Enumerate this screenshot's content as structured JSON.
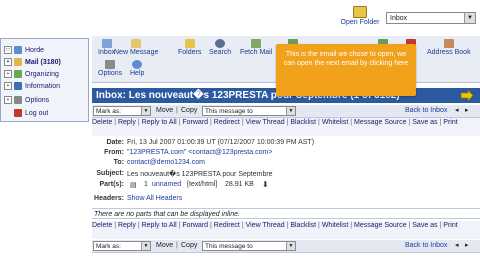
{
  "top": {
    "open_folder_label": "Open Folder",
    "folder_select_value": "Inbox"
  },
  "sidebar": {
    "items": [
      {
        "label": "Horde"
      },
      {
        "label": "Mail (3180)"
      },
      {
        "label": "Organizing"
      },
      {
        "label": "Information"
      },
      {
        "label": "Options"
      },
      {
        "label": "Log out"
      }
    ]
  },
  "toolbar": {
    "buttons": [
      {
        "label": "Inbox"
      },
      {
        "label": "New Message"
      },
      {
        "label": "Folders"
      },
      {
        "label": "Search"
      },
      {
        "label": "Fetch Mail"
      },
      {
        "label": "Address Book"
      },
      {
        "label": "Options"
      },
      {
        "label": "Help"
      }
    ]
  },
  "callout": {
    "text": "This is the email we chose to open, we can open the next email by clicking here"
  },
  "message": {
    "title": "Inbox: Les nouveaut�s 123PRESTA pour Septembre (1 of 3182)"
  },
  "actions": {
    "mark_as": "Mark as:",
    "move": "Move",
    "copy": "Copy",
    "this_message_to": "This message to",
    "back_to_inbox": "Back to Inbox"
  },
  "links": {
    "row": [
      "Delete",
      "Reply",
      "Reply to All",
      "Forward",
      "Redirect",
      "View Thread",
      "Blacklist",
      "Whitelist",
      "Message Source",
      "Save as",
      "Print"
    ]
  },
  "headers": {
    "date_label": "Date:",
    "date_value": "Fri, 13 Jul 2007 01:00:39 UT (07/12/2007 10:00:39 PM AST)",
    "from_label": "From:",
    "from_value": "\"123PRESTA.com\" <contact@123presta.com>",
    "to_label": "To:",
    "to_value": "contact@demo1234.com",
    "subject_label": "Subject:",
    "subject_value": "Les nouveaut�s 123PRESTA pour Septembre",
    "parts_label": "Part(s):",
    "parts_num": "1",
    "parts_name": "unnamed",
    "parts_type": "[text/html]",
    "parts_size": "28.91 KB",
    "headers_label": "Headers:",
    "headers_value": "Show All Headers"
  },
  "body": {
    "no_parts": "There are no parts that can be displayed inline."
  },
  "colors": {
    "title_bar": "#2c5aa0",
    "callout": "#f2a11a",
    "link": "#1a3d9f"
  }
}
